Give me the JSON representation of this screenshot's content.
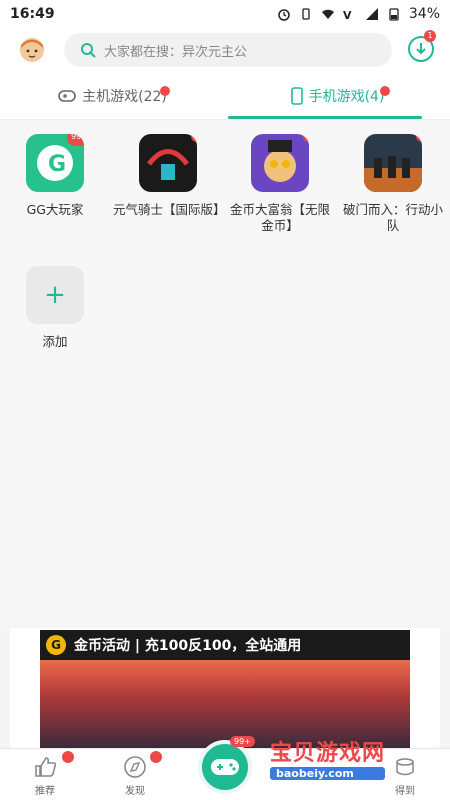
{
  "status": {
    "time": "16:49",
    "battery": "34%"
  },
  "header": {
    "search_placeholder": "大家都在搜：异次元主公",
    "download_badge": "1"
  },
  "tabs": [
    {
      "label": "主机游戏(22)"
    },
    {
      "label": "手机游戏(4)"
    }
  ],
  "apps": [
    {
      "label": "GG大玩家",
      "badge": "99+",
      "color": "#27c18b"
    },
    {
      "label": "元气骑士【国际版】",
      "badge": "",
      "color": "#1a1a1a"
    },
    {
      "label": "金币大富翁【无限金币】",
      "badge": "",
      "color": "#6b46c2"
    },
    {
      "label": "破门而入：行动小队",
      "badge": "",
      "color": "#2b3a4a"
    }
  ],
  "add_tile": {
    "label": "添加"
  },
  "banner": {
    "title": "金币活动 | 充100反100，全站通用",
    "brand_letter": "G"
  },
  "nav": [
    {
      "label": "推荐"
    },
    {
      "label": "发现"
    },
    {
      "label": "得到"
    }
  ],
  "center_badge": "99+",
  "watermark": {
    "title": "宝贝游戏网",
    "url": "baobeiy.com"
  },
  "colors": {
    "accent": "#1fb994",
    "badge": "#f04848"
  }
}
